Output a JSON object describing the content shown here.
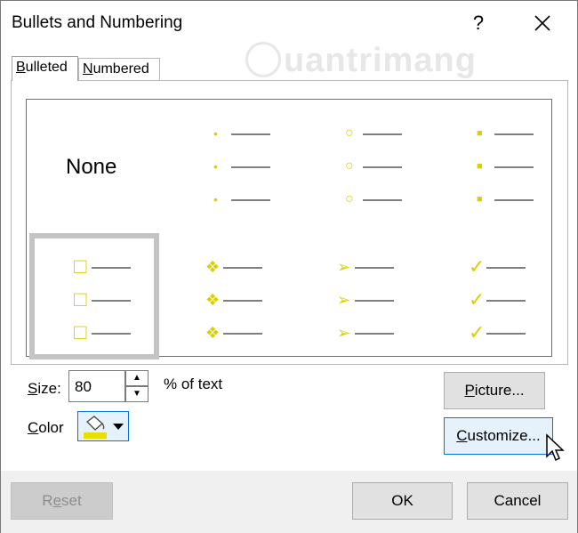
{
  "dialog": {
    "title": "Bullets and Numbering",
    "help_glyph": "?",
    "watermark": "uantrimang"
  },
  "tabs": [
    {
      "label_underline": "B",
      "label_rest": "ulleted",
      "active": true
    },
    {
      "label_underline": "N",
      "label_rest": "umbered",
      "active": false
    }
  ],
  "gallery": {
    "none_label": "None",
    "bullet_color": "#d8d000",
    "line_color": "#7f7f7f",
    "selected_index": 4,
    "glyphs": {
      "filled-dot": "•",
      "hollow-circle": "○",
      "filled-square": "■",
      "hollow-square": "□",
      "four-diamond": "❖",
      "arrowhead": "➢",
      "checkmark": "✓"
    }
  },
  "size": {
    "label_underline": "S",
    "label_rest": "ize:",
    "value": "80",
    "unit_text": "% of text"
  },
  "color": {
    "label_underline": "C",
    "label_rest": "olor",
    "swatch": "#e8e000"
  },
  "buttons": {
    "picture": {
      "label_underline": "P",
      "label_rest": "icture..."
    },
    "customize": {
      "label_underline": "C",
      "label_rest": "ustomize..."
    },
    "reset": {
      "label_pre": "R",
      "label_underline": "e",
      "label_rest": "set"
    },
    "ok": "OK",
    "cancel": "Cancel"
  }
}
